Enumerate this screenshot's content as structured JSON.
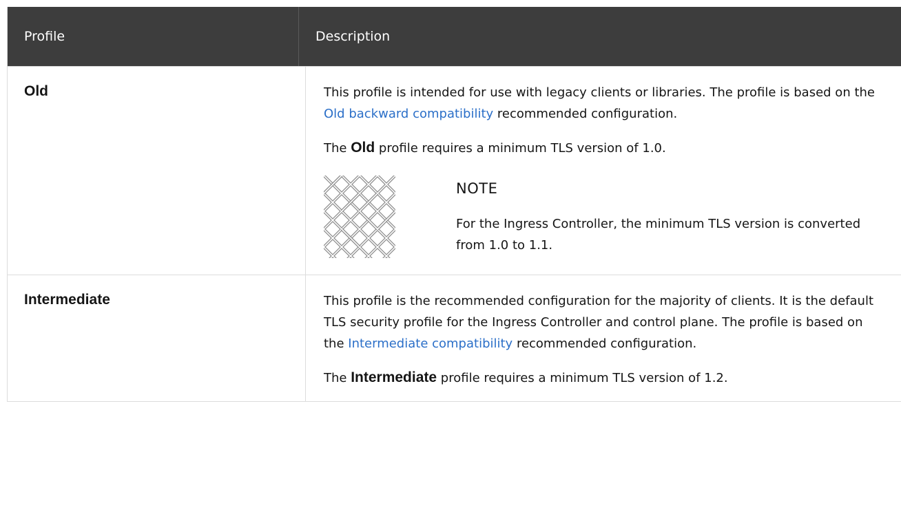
{
  "table": {
    "headers": {
      "profile": "Profile",
      "description": "Description"
    },
    "rows": [
      {
        "profile": "Old",
        "desc_p1_before": "This profile is intended for use with legacy clients or libraries. The profile is based on the ",
        "desc_p1_link": "Old backward compatibility",
        "desc_p1_after": " recommended configuration.",
        "desc_p2_before": "The ",
        "desc_p2_bold": "Old",
        "desc_p2_after": " profile requires a minimum TLS version of 1.0.",
        "note": {
          "icon": "note-pattern-icon",
          "title": "NOTE",
          "text": "For the Ingress Controller, the minimum TLS version is converted from 1.0 to 1.1."
        }
      },
      {
        "profile": "Intermediate",
        "desc_p1_before": "This profile is the recommended configuration for the majority of clients. It is the default TLS security profile for the Ingress Controller and control plane. The profile is based on the ",
        "desc_p1_link": "Intermediate compatibility",
        "desc_p1_after": " recommended configuration.",
        "desc_p2_before": "The ",
        "desc_p2_bold": "Intermediate",
        "desc_p2_after": " profile requires a minimum TLS version of 1.2."
      }
    ]
  },
  "colors": {
    "header_bg": "#3d3d3d",
    "link": "#2b6fc8",
    "border": "#dcdcdc"
  }
}
